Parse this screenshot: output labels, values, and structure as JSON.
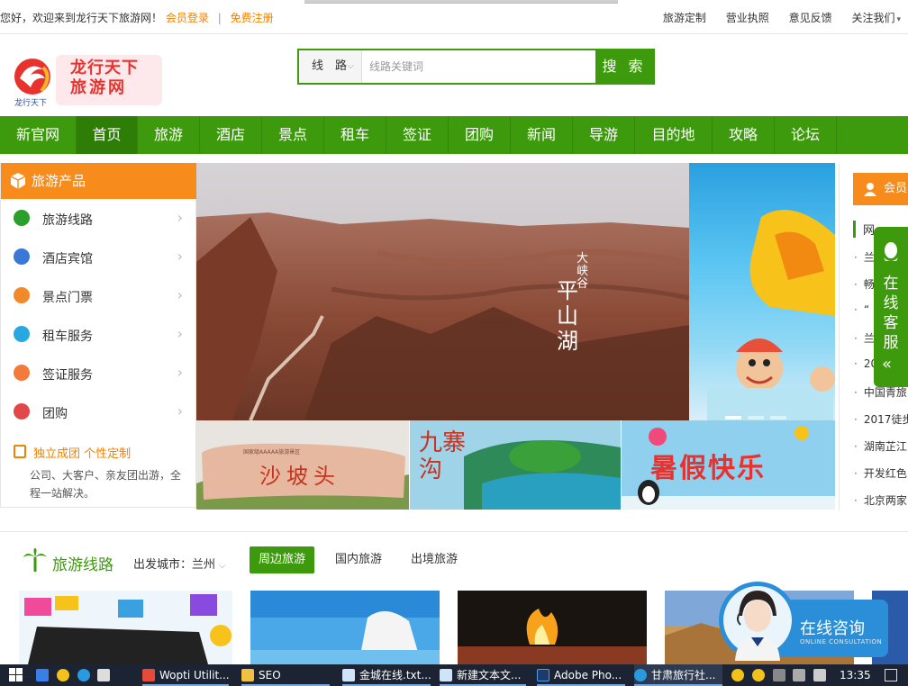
{
  "topbar": {
    "welcome": "您好，欢迎来到龙行天下旅游网！",
    "login": "会员登录",
    "separator": "|",
    "register": "免费注册",
    "links": [
      "旅游定制",
      "营业执照",
      "意见反馈",
      "关注我们"
    ]
  },
  "header": {
    "logo_text_1": "龙行天下",
    "logo_text_2": "旅游网",
    "logo_sub": "龙行天下",
    "search_scope": "线　路",
    "search_placeholder": "线路关键词",
    "search_button": "搜 索"
  },
  "nav": {
    "items": [
      "新官网",
      "首页",
      "旅游",
      "酒店",
      "景点",
      "租车",
      "签证",
      "团购",
      "新闻",
      "导游",
      "目的地",
      "攻略",
      "论坛"
    ],
    "active": "首页"
  },
  "products": {
    "title": "旅游产品",
    "items": [
      {
        "label": "旅游线路",
        "icon": "route-icon",
        "color": "#2aa02a"
      },
      {
        "label": "酒店宾馆",
        "icon": "hotel-icon",
        "color": "#3a78d8"
      },
      {
        "label": "景点门票",
        "icon": "ticket-icon",
        "color": "#f08a2a"
      },
      {
        "label": "租车服务",
        "icon": "car-icon",
        "color": "#29a7e1"
      },
      {
        "label": "签证服务",
        "icon": "visa-icon",
        "color": "#f37a3a"
      },
      {
        "label": "团购",
        "icon": "tag-icon",
        "color": "#e34848"
      }
    ],
    "custom_title": "独立成团 个性定制",
    "custom_desc": "公司、大客户、亲友团出游，全程一站解决。"
  },
  "banner": {
    "caption_small": "大峡谷",
    "caption_large": "平山湖"
  },
  "thumbs": {
    "t1": "沙坡头",
    "t1_small": "国家级AAAAA旅游景区",
    "t2": "九寨沟",
    "t3": "暑假快乐"
  },
  "rightpanel": {
    "member": "会员",
    "news_title": "网",
    "news": [
      "兰",
      "畅",
      "“",
      "兰",
      "20",
      "中国青旅",
      "2017徒步",
      "湖南芷江",
      "开发红色",
      "北京两家"
    ]
  },
  "kefu": {
    "text": "在线客服",
    "collapse": "«"
  },
  "lines": {
    "title": "旅游线路",
    "city_label": "出发城市：兰州",
    "tabs": [
      "周边旅游",
      "国内旅游",
      "出境旅游"
    ],
    "active_tab": "周边旅游"
  },
  "consult": {
    "title": "在线咨询",
    "subtitle": "ONLINE CONSULTATION"
  },
  "taskbar": {
    "items": [
      "Wopti Utilit...",
      "SEO",
      "金城在线.txt...",
      "新建文本文...",
      "Adobe Pho...",
      "甘肃旅行社..."
    ],
    "ime": "英",
    "time": "13:35"
  },
  "colors": {
    "brand_green": "#3c9a0c",
    "accent_orange": "#f78b1b"
  }
}
